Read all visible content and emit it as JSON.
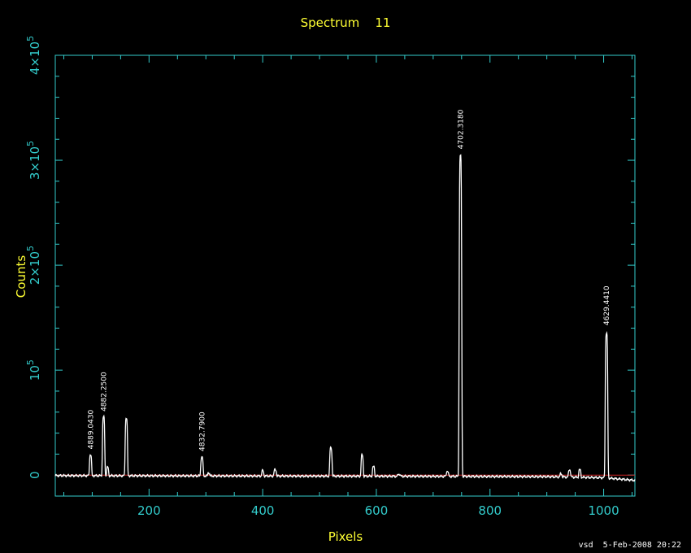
{
  "page": {
    "title": "Spectrum    11",
    "stamp": "vsd  5-Feb-2008 20:22"
  },
  "colors": {
    "axes": "#33cccc",
    "labels": "#ffff33",
    "spectrum": "#ffffff",
    "baseline": "#cc2222"
  },
  "chart_data": {
    "type": "line",
    "title": "Spectrum    11",
    "xlabel": "Pixels",
    "ylabel": "Counts",
    "xlim": [
      35,
      1055
    ],
    "ylim": [
      -20000,
      400000
    ],
    "xticks": [
      {
        "value": 200,
        "label": "200"
      },
      {
        "value": 400,
        "label": "400"
      },
      {
        "value": 600,
        "label": "600"
      },
      {
        "value": 800,
        "label": "800"
      },
      {
        "value": 1000,
        "label": "1000"
      }
    ],
    "yticks": [
      {
        "value": 0,
        "mant": "0",
        "exp": ""
      },
      {
        "value": 100000,
        "mant": "10",
        "exp": "5"
      },
      {
        "value": 200000,
        "mant": "2×10",
        "exp": "5"
      },
      {
        "value": 300000,
        "mant": "3×10",
        "exp": "5"
      },
      {
        "value": 400000,
        "mant": "4×10",
        "exp": "5"
      }
    ],
    "baseline": 0,
    "continuum": [
      [
        35,
        -500
      ],
      [
        300,
        -800
      ],
      [
        500,
        -1000
      ],
      [
        700,
        -1200
      ],
      [
        900,
        -1500
      ],
      [
        1000,
        -2500
      ],
      [
        1055,
        -5000
      ]
    ],
    "peaks": [
      {
        "x": 97,
        "height": 20000,
        "width": 2.2
      },
      {
        "x": 120,
        "height": 56000,
        "width": 2.4
      },
      {
        "x": 127,
        "height": 8000,
        "width": 2.0
      },
      {
        "x": 160,
        "height": 55000,
        "width": 2.4
      },
      {
        "x": 293,
        "height": 18000,
        "width": 2.4
      },
      {
        "x": 305,
        "height": 3000,
        "width": 2.0
      },
      {
        "x": 400,
        "height": 5000,
        "width": 2.0
      },
      {
        "x": 422,
        "height": 6000,
        "width": 2.5
      },
      {
        "x": 520,
        "height": 27000,
        "width": 2.4
      },
      {
        "x": 575,
        "height": 20000,
        "width": 2.2
      },
      {
        "x": 595,
        "height": 9000,
        "width": 2.2
      },
      {
        "x": 640,
        "height": 2000,
        "width": 2.5
      },
      {
        "x": 725,
        "height": 5000,
        "width": 2.2
      },
      {
        "x": 748,
        "height": 306000,
        "width": 2.6
      },
      {
        "x": 925,
        "height": 3000,
        "width": 2.0
      },
      {
        "x": 940,
        "height": 7000,
        "width": 2.2
      },
      {
        "x": 958,
        "height": 7000,
        "width": 2.2
      },
      {
        "x": 1005,
        "height": 138000,
        "width": 2.6
      }
    ],
    "annotations": [
      {
        "x": 97,
        "y": 20000,
        "label": "4889.0430"
      },
      {
        "x": 120,
        "y": 56000,
        "label": "4882.2500"
      },
      {
        "x": 293,
        "y": 18000,
        "label": "4832.7900"
      },
      {
        "x": 748,
        "y": 306000,
        "label": "4702.3180"
      },
      {
        "x": 1005,
        "y": 138000,
        "label": "4629.4410"
      }
    ]
  }
}
